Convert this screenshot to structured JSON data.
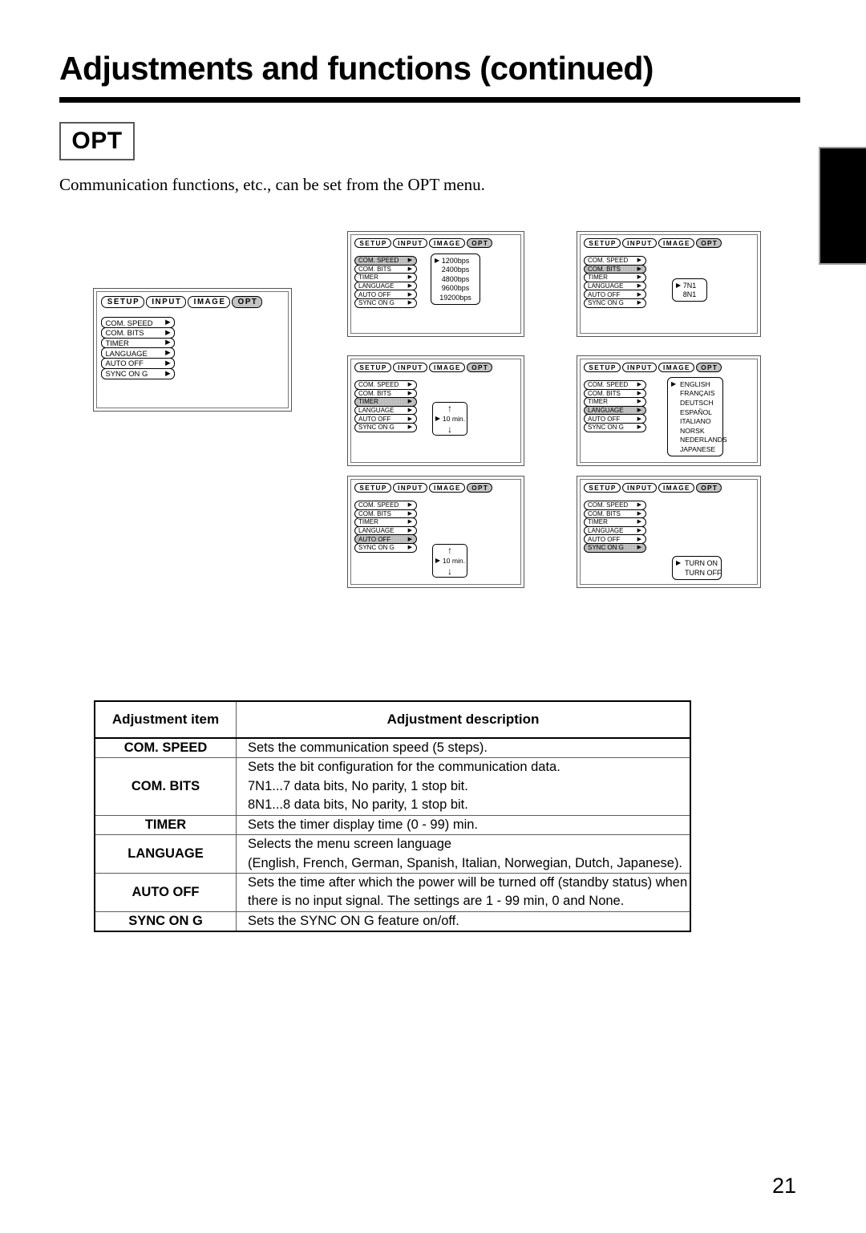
{
  "header": {
    "title": "Adjustments and functions (continued)",
    "badge": "OPT",
    "intro": "Communication functions, etc., can be set from the OPT menu."
  },
  "osd": {
    "tabs": [
      "SETUP",
      "INPUT",
      "IMAGE",
      "OPT"
    ],
    "selected_tab": "OPT",
    "menu_items": [
      "COM. SPEED",
      "COM. BITS",
      "TIMER",
      "LANGUAGE",
      "AUTO OFF",
      "SYNC ON G"
    ],
    "arrow_glyph": "▶",
    "up_glyph": "↑",
    "down_glyph": "↓"
  },
  "screens": [
    {
      "name": "opt-main-menu",
      "selected_item": null,
      "values": []
    },
    {
      "name": "com-speed-menu",
      "selected_item": "COM. SPEED",
      "values": [
        "1200bps",
        "2400bps",
        "4800bps",
        "9600bps",
        "19200bps"
      ],
      "marked_value": "1200bps"
    },
    {
      "name": "com-bits-menu",
      "selected_item": "COM. BITS",
      "values": [
        "7N1",
        "8N1"
      ],
      "marked_value": "7N1"
    },
    {
      "name": "timer-menu",
      "selected_item": "TIMER",
      "stepper_value": "10  min."
    },
    {
      "name": "language-menu",
      "selected_item": "LANGUAGE",
      "values": [
        "ENGLISH",
        "FRANÇAIS",
        "DEUTSCH",
        "ESPAÑOL",
        "ITALIANO",
        "NORSK",
        "NEDERLANDS",
        "JAPANESE"
      ],
      "marked_value": "ENGLISH"
    },
    {
      "name": "auto-off-menu",
      "selected_item": "AUTO OFF",
      "stepper_value": "10  min."
    },
    {
      "name": "sync-on-g-menu",
      "selected_item": "SYNC ON G",
      "values": [
        "TURN ON",
        "TURN OFF"
      ],
      "marked_value": "TURN ON"
    }
  ],
  "table": {
    "headers": [
      "Adjustment item",
      "Adjustment description"
    ],
    "rows": [
      {
        "item": "COM. SPEED",
        "lines": [
          "Sets the communication speed (5 steps)."
        ]
      },
      {
        "item": "COM. BITS",
        "lines": [
          "Sets the bit configuration for the communication data.",
          "7N1...7 data bits, No parity, 1 stop bit.",
          "8N1...8 data bits, No parity, 1 stop bit."
        ]
      },
      {
        "item": "TIMER",
        "lines": [
          "Sets the timer display time (0 - 99) min."
        ]
      },
      {
        "item": "LANGUAGE",
        "lines": [
          "Selects the menu screen language",
          "(English, French, German, Spanish, Italian, Norwegian, Dutch, Japanese)."
        ]
      },
      {
        "item": "AUTO OFF",
        "lines": [
          "Sets the time after which the power will be turned off (standby status) when",
          "there is no input signal. The settings are 1 - 99 min, 0 and None."
        ]
      },
      {
        "item": "SYNC ON G",
        "lines": [
          "Sets the SYNC ON G feature on/off."
        ]
      }
    ]
  },
  "footer": {
    "page_number": "21"
  }
}
